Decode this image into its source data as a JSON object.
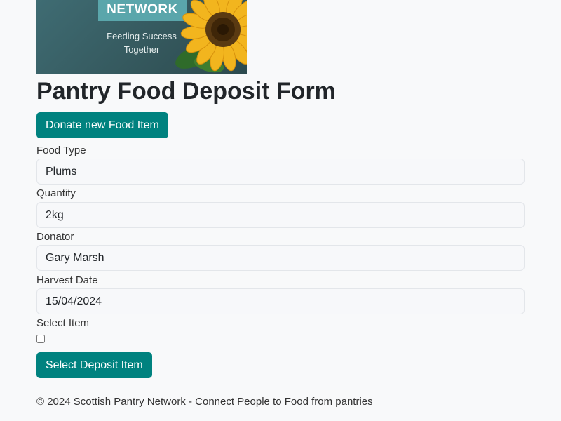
{
  "logo": {
    "banner": "NETWORK",
    "tagline_1": "Feeding Success",
    "tagline_2": "Together"
  },
  "page_title": "Pantry Food Deposit Form",
  "donate_button_label": "Donate new Food Item",
  "form": {
    "food_type": {
      "label": "Food Type",
      "value": "Plums"
    },
    "quantity": {
      "label": "Quantity",
      "value": "2kg"
    },
    "donator": {
      "label": "Donator",
      "value": "Gary Marsh"
    },
    "harvest_date": {
      "label": "Harvest Date",
      "value": "15/04/2024"
    },
    "select_item": {
      "label": "Select Item",
      "checked": false
    }
  },
  "select_button_label": "Select Deposit Item",
  "footer": "© 2024 Scottish Pantry Network - Connect People to Food from pantries",
  "colors": {
    "accent": "#00827f",
    "background": "#f8f9fa",
    "logo_background": "#3f6c73",
    "logo_banner": "#5aa6ab"
  }
}
